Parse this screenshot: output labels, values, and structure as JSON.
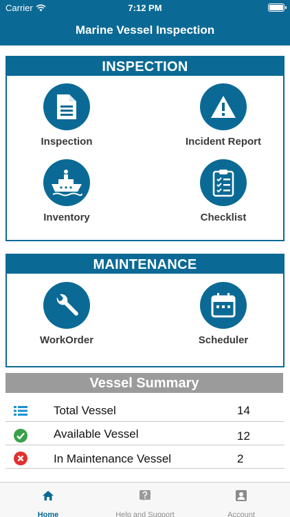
{
  "status_bar": {
    "carrier": "Carrier",
    "time": "7:12 PM"
  },
  "nav": {
    "title": "Marine Vessel Inspection"
  },
  "inspection_panel": {
    "title": "INSPECTION",
    "tiles": [
      {
        "label": "Inspection",
        "icon": "document-icon"
      },
      {
        "label": "Incident Report",
        "icon": "warning-icon"
      },
      {
        "label": "Inventory",
        "icon": "ship-icon"
      },
      {
        "label": "Checklist",
        "icon": "clipboard-icon"
      }
    ]
  },
  "maintenance_panel": {
    "title": "MAINTENANCE",
    "tiles": [
      {
        "label": "WorkOrder",
        "icon": "wrench-icon"
      },
      {
        "label": "Scheduler",
        "icon": "calendar-icon"
      }
    ]
  },
  "summary": {
    "title": "Vessel Summary",
    "rows": [
      {
        "label": "Total Vessel",
        "count": "14",
        "icon": "list-icon"
      },
      {
        "label": "Available Vessel",
        "count": "12",
        "icon": "check-circle-icon"
      },
      {
        "label": "In Maintenance Vessel",
        "count": "2",
        "icon": "error-circle-icon"
      }
    ]
  },
  "tab_bar": {
    "items": [
      {
        "label": "Home",
        "icon": "home-icon",
        "active": true
      },
      {
        "label": "Help and Support",
        "icon": "help-icon",
        "active": false
      },
      {
        "label": "Account",
        "icon": "account-icon",
        "active": false
      }
    ]
  },
  "colors": {
    "brand": "#0b6a95",
    "summary_header": "#9b9b9b",
    "success": "#3aa14a",
    "error": "#e0302e"
  }
}
